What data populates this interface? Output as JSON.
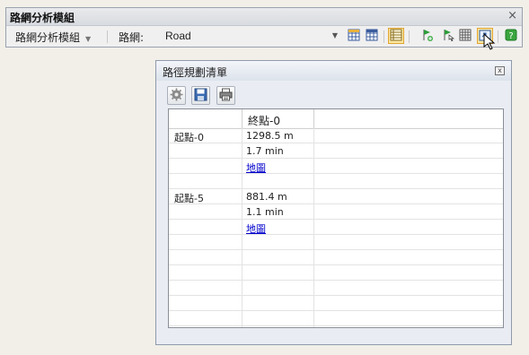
{
  "toolbar": {
    "title": "路網分析模組",
    "menu_label": "路網分析模組",
    "network_label": "路網:",
    "network_value": "Road",
    "close_symbol": "×"
  },
  "panel": {
    "title": "路徑規劃清單",
    "close_symbol": "x"
  },
  "grid": {
    "columns": [
      "",
      "終點-0",
      ""
    ],
    "routes": [
      {
        "origin": "起點-0",
        "distance": "1298.5 m",
        "time": "1.7 min",
        "map_link": "地圖"
      },
      {
        "origin": "起點-5",
        "distance": "881.4 m",
        "time": "1.1 min",
        "map_link": "地圖"
      }
    ]
  },
  "colors": {
    "accent_active": "#fbe7a1",
    "link": "#0000cc",
    "panel_bg": "#e9ecf2"
  },
  "icons": [
    "grid-icon",
    "grid-sum-icon",
    "table-list-icon",
    "flag-add-icon",
    "flag-pointer-icon",
    "grid-icon",
    "export-icon",
    "help-icon",
    "gear-icon",
    "save-icon",
    "print-icon"
  ]
}
